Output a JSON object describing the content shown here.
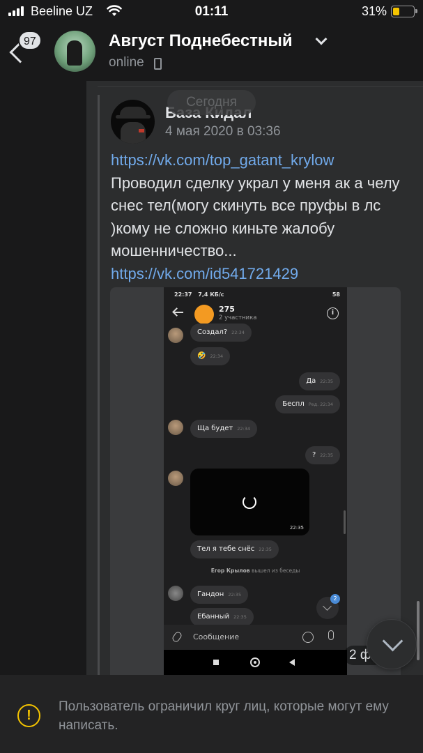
{
  "status_bar": {
    "carrier": "Beeline UZ",
    "time": "01:11",
    "battery_percent": "31%"
  },
  "header": {
    "unread_badge": "97",
    "contact_name": "Август Поднебестный",
    "presence": "online"
  },
  "chat": {
    "date_chip": "Сегодня",
    "post": {
      "author": "База Кидал",
      "date": "4 мая 2020 в 03:36",
      "link_top": "https://vk.com/top_gatant_krylow",
      "body": "Проводил сделку украл у меня ак а челу снес тел(могу скинуть все пруфы в лс )кому не сложно киньте жалобу мошенничество...",
      "link_bottom": "https://vk.com/id541721429",
      "photos_label": "2 фо"
    }
  },
  "embedded_screenshot": {
    "status_time": "22:37",
    "status_speed": "7,4 КБ/с",
    "status_right": "58",
    "chat_title": "275",
    "chat_subtitle": "2 участника",
    "messages": [
      {
        "text": "Создал?",
        "time": "22:34"
      },
      {
        "text": "🤣",
        "time": "22:34"
      },
      {
        "text": "Да",
        "time": "22:35"
      },
      {
        "text": "Беспл",
        "time": "Ред. 22:34"
      },
      {
        "text": "Ща будет",
        "time": "22:34"
      },
      {
        "text": "?",
        "time": "22:35"
      },
      {
        "text": "Тел я тебе снёс",
        "time": "22:35"
      },
      {
        "text": "Гандон",
        "time": "22:35"
      },
      {
        "text": "Ебанный",
        "time": "22:35"
      }
    ],
    "video_time": "22:35",
    "system_user": "Егор Крылов",
    "system_action": " вышел из беседы",
    "unread_count": "2",
    "input_placeholder": "Сообщение"
  },
  "banner": {
    "text": "Пользователь ограничил круг лиц, которые могут ему написать."
  },
  "colors": {
    "background": "#19191a",
    "bubble": "#2c2d2e",
    "link": "#71aaeb",
    "warning": "#f5c400",
    "battery": "#f5c400"
  },
  "icons": [
    "signal-icon",
    "wifi-icon",
    "battery-icon",
    "back-icon",
    "chevron-down-icon",
    "phone-icon",
    "warning-icon",
    "scroll-down-icon"
  ]
}
